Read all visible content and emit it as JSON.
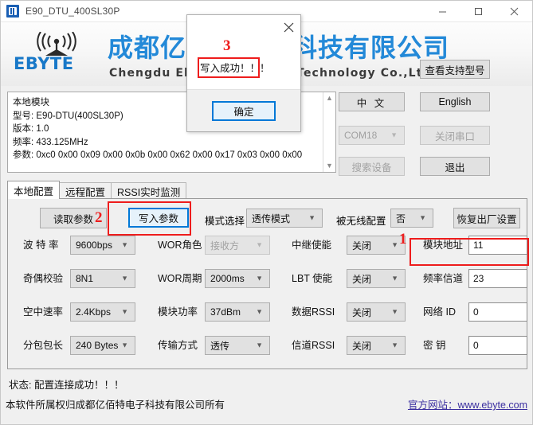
{
  "window": {
    "title": "E90_DTU_400SL30P",
    "icon": "app-icon",
    "minimize": "minimize-icon",
    "maximize": "maximize-icon",
    "close": "close-icon"
  },
  "banner": {
    "logo_word": "EBYTE",
    "brand_cn": "成都亿佰特电子科技有限公司",
    "brand_en": "Chengdu Ebyte Electronic Technology Co.,Ltd."
  },
  "info_panel": {
    "lines": [
      "本地模块",
      "型号: E90-DTU(400SL30P)",
      "版本: 1.0",
      "频率: 433.125MHz",
      "参数:  0xc0 0x00 0x09 0x00 0x0b 0x00 0x62 0x00 0x17 0x03 0x00 0x00"
    ],
    "scroll_up": "▲",
    "scroll_down": "▼"
  },
  "side_controls": {
    "view_models": "查看支持型号",
    "chinese": "中 文",
    "english": "English",
    "com_port": "COM18",
    "close_port": "关闭串口",
    "search_device": "搜索设备",
    "exit": "退出"
  },
  "tabs": [
    {
      "label": "本地配置",
      "active": true
    },
    {
      "label": "远程配置",
      "active": false
    },
    {
      "label": "RSSI实时监测",
      "active": false
    }
  ],
  "toolbar": {
    "read_params": "读取参数",
    "write_params": "写入参数",
    "mode_label": "模式选择",
    "mode_value": "透传模式",
    "wireless_cfg_label": "被无线配置",
    "wireless_cfg_value": "否",
    "factory_reset": "恢复出厂设置"
  },
  "params": {
    "col1": [
      {
        "label": "波 特 率",
        "value": "9600bps",
        "type": "combo",
        "disabled": false
      },
      {
        "label": "奇偶校验",
        "value": "8N1",
        "type": "combo",
        "disabled": false
      },
      {
        "label": "空中速率",
        "value": "2.4Kbps",
        "type": "combo",
        "disabled": false
      },
      {
        "label": "分包包长",
        "value": "240 Bytes",
        "type": "combo",
        "disabled": false
      }
    ],
    "col2": [
      {
        "label": "WOR角色",
        "value": "接收方",
        "type": "combo",
        "disabled": true
      },
      {
        "label": "WOR周期",
        "value": "2000ms",
        "type": "combo",
        "disabled": false
      },
      {
        "label": "模块功率",
        "value": "37dBm",
        "type": "combo",
        "disabled": false
      },
      {
        "label": "传输方式",
        "value": "透传",
        "type": "combo",
        "disabled": false
      }
    ],
    "col3": [
      {
        "label": "中继使能",
        "value": "关闭",
        "type": "combo",
        "disabled": false
      },
      {
        "label": "LBT 使能",
        "value": "关闭",
        "type": "combo",
        "disabled": false
      },
      {
        "label": "数据RSSI",
        "value": "关闭",
        "type": "combo",
        "disabled": false
      },
      {
        "label": "信道RSSI",
        "value": "关闭",
        "type": "combo",
        "disabled": false
      }
    ],
    "col4": [
      {
        "label": "模块地址",
        "value": "11",
        "type": "text"
      },
      {
        "label": "频率信道",
        "value": "23",
        "type": "text"
      },
      {
        "label": "网络  ID",
        "value": "0",
        "type": "text"
      },
      {
        "label": "密    钥",
        "value": "0",
        "type": "text"
      }
    ]
  },
  "footer": {
    "status": "状态: 配置连接成功！！！",
    "copyright": "本软件所属权归成都亿佰特电子科技有限公司所有",
    "website": "官方网站：www.ebyte.com"
  },
  "dialog": {
    "message": "写入成功！！！",
    "ok": "确定",
    "close": "close-icon"
  },
  "annotations": [
    {
      "number": "1",
      "target": "module-address-field"
    },
    {
      "number": "2",
      "target": "write-params-button"
    },
    {
      "number": "3",
      "target": "dialog-message"
    }
  ],
  "colors": {
    "brand_blue": "#2389d8",
    "annotation_red": "#ee1c1c",
    "focus_blue": "#0078d7",
    "link_purple": "#3b2fa0"
  }
}
